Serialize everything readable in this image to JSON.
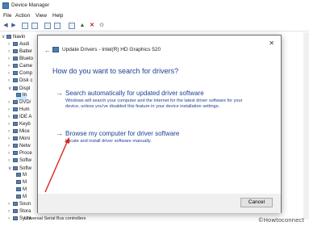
{
  "window": {
    "title": "Device Manager"
  },
  "menu": [
    "File",
    "Action",
    "View",
    "Help"
  ],
  "tree": {
    "root": "Navin",
    "items": [
      "Audi",
      "Batter",
      "Blueto",
      "Came",
      "Comp",
      "Disk c",
      "Displ",
      "In",
      "DVD/",
      "Hum",
      "IDE A",
      "Keyb",
      "Mice",
      "Moni",
      "Netw",
      "Proce",
      "Softw",
      "Softw",
      "M",
      "M",
      "M",
      "M",
      "Soun",
      "Stora",
      "Syste"
    ],
    "bottom_item": "Universal Serial Bus controllers"
  },
  "dialog": {
    "title": "Update Drivers - Intel(R) HD Graphics 520",
    "heading": "How do you want to search for drivers?",
    "option1": {
      "title": "Search automatically for updated driver software",
      "description": "Windows will search your computer and the Internet for the latest driver software for your device, unless you've disabled this feature in your device installation settings."
    },
    "option2": {
      "title": "Browse my computer for driver software",
      "description": "Locate and install driver software manually."
    },
    "cancel_label": "Cancel",
    "close_glyph": "✕",
    "back_glyph": "←"
  },
  "watermark": "©Howtoconnect"
}
